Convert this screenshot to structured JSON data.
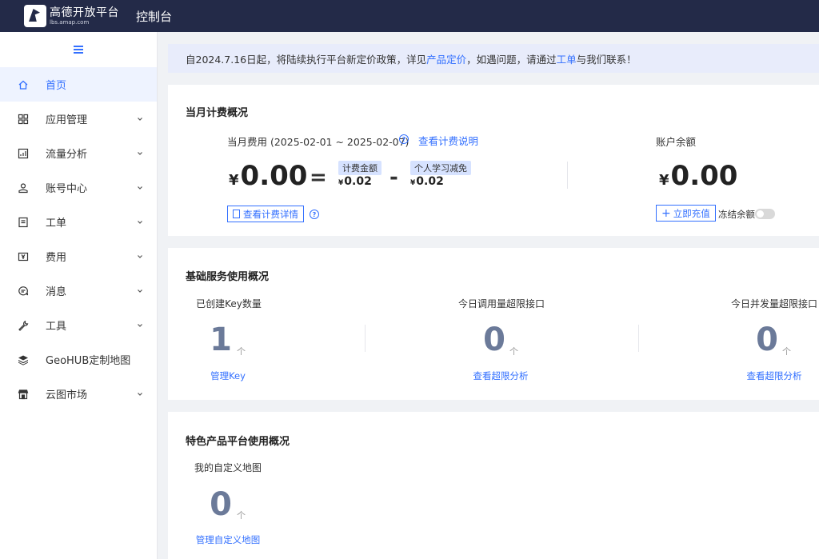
{
  "header": {
    "logo_cn": "高德开放平台",
    "logo_en": "lbs.amap.com",
    "console_title": "控制台"
  },
  "sidebar": {
    "items": [
      {
        "label": "首页",
        "icon": "home-icon",
        "active": true,
        "has_children": false
      },
      {
        "label": "应用管理",
        "icon": "grid-icon",
        "active": false,
        "has_children": true
      },
      {
        "label": "流量分析",
        "icon": "chart-icon",
        "active": false,
        "has_children": true
      },
      {
        "label": "账号中心",
        "icon": "user-icon",
        "active": false,
        "has_children": true
      },
      {
        "label": "工单",
        "icon": "ticket-icon",
        "active": false,
        "has_children": true
      },
      {
        "label": "费用",
        "icon": "yen-icon",
        "active": false,
        "has_children": true
      },
      {
        "label": "消息",
        "icon": "message-icon",
        "active": false,
        "has_children": true
      },
      {
        "label": "工具",
        "icon": "wrench-icon",
        "active": false,
        "has_children": true
      },
      {
        "label": "GeoHUB定制地图",
        "icon": "layers-icon",
        "active": false,
        "has_children": false
      },
      {
        "label": "云图市场",
        "icon": "store-icon",
        "active": false,
        "has_children": true
      }
    ]
  },
  "notice": {
    "prefix": "自2024.7.16日起，将陆续执行平台新定价政策，详见",
    "pricing_link": "产品定价",
    "middle": "，如遇问题，请通过",
    "ticket_link": "工单",
    "suffix": "与我们联系！"
  },
  "billing": {
    "title": "当月计费概况",
    "fee_label": "当月费用 (2025-02-01 ~ 2025-02-07)",
    "explain_link": "查看计费说明",
    "currency": "¥",
    "current_amount": "0.00",
    "equals": "=",
    "minus": "-",
    "charge_tag": "计费金额",
    "charge_amount": "0.02",
    "discount_tag": "个人学习减免",
    "discount_amount": "0.02",
    "detail_button": "查看计费详情",
    "balance_label": "账户余额",
    "balance_amount": "0.00",
    "recharge_button": "立即充值",
    "freeze_label": "冻结余额",
    "freeze_toggle_on": false
  },
  "basic_service": {
    "title": "基础服务使用概况",
    "stats": [
      {
        "label": "已创建Key数量",
        "value": "1",
        "unit": "个",
        "link": "管理Key"
      },
      {
        "label": "今日调用量超限接口",
        "value": "0",
        "unit": "个",
        "link": "查看超限分析"
      },
      {
        "label": "今日并发量超限接口",
        "value": "0",
        "unit": "个",
        "link": "查看超限分析"
      }
    ]
  },
  "featured": {
    "title": "特色产品平台使用概况",
    "stats": [
      {
        "label": "我的自定义地图",
        "value": "0",
        "unit": "个",
        "link": "管理自定义地图"
      }
    ]
  },
  "colors": {
    "header_bg": "#232a48",
    "accent": "#3370ff",
    "notice_bg": "#e8ecfb",
    "stat_number": "#6b7a99"
  }
}
